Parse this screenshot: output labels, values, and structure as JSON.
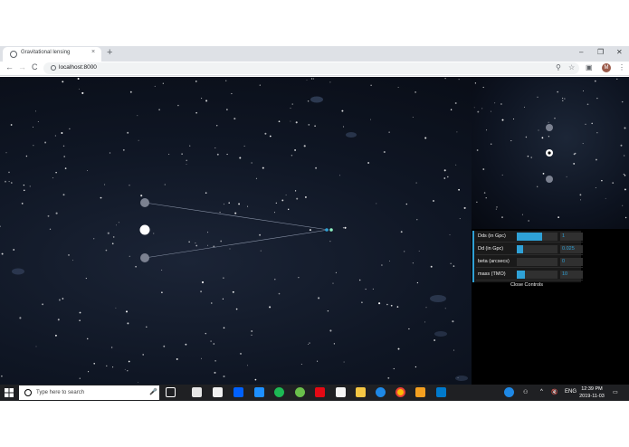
{
  "browser": {
    "tab_title": "Gravitational lensing",
    "tab_close": "×",
    "new_tab": "+",
    "minimize": "–",
    "restore": "❐",
    "close": "✕",
    "back": "←",
    "forward": "→",
    "reload": "C",
    "url": "localhost:8000",
    "zoom_icon": "⚲",
    "star_icon": "☆",
    "ext_icon": "▣",
    "avatar_letter": "M",
    "menu_icon": "⋮"
  },
  "controls": {
    "rows": [
      {
        "label": "Dds (in Gpc)",
        "value": "1",
        "fill_percent": 62
      },
      {
        "label": "Dd (in Gpc)",
        "value": "0.025",
        "fill_percent": 15
      },
      {
        "label": "beta (arcsecs)",
        "value": "0",
        "fill_percent": 0
      },
      {
        "label": "mass (TMO)",
        "value": "10",
        "fill_percent": 20
      }
    ],
    "close_label": "Close Controls",
    "accent": "#2fa1d6"
  },
  "taskbar": {
    "search_placeholder": "Type here to search",
    "mic_icon": "🎤",
    "tray_lang": "ENG",
    "time": "12:39 PM",
    "date": "2019-11-03",
    "tray_up": "^",
    "tray_volume": "🔇"
  }
}
